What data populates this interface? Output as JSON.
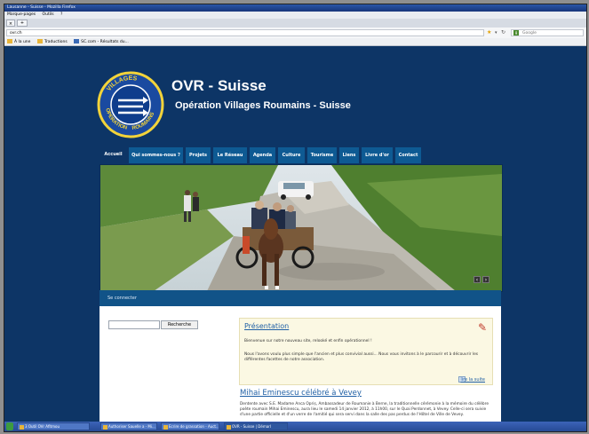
{
  "browser": {
    "title": "Lausanne - Suisse - Mozilla Firefox",
    "menu": [
      "Marque-pages",
      "Outils",
      "?"
    ],
    "tab_close": "×",
    "new_tab": "+",
    "url": "ovr.ch",
    "search_engine_label": "g",
    "search_placeholder": "Google",
    "bookmarks": [
      "À la une",
      "Traductions",
      "SC.com - Résultats du..."
    ]
  },
  "site": {
    "title": "OVR - Suisse",
    "subtitle": "Opération Villages Roumains - Suisse",
    "logo": {
      "top_arc": "VILLAGES",
      "right_arc": "ROUMAINS",
      "left_arc": "OPERATION"
    }
  },
  "nav": [
    {
      "label": "Accueil",
      "active": true
    },
    {
      "label": "Qui sommes-nous ?"
    },
    {
      "label": "Projets"
    },
    {
      "label": "Le Réseau"
    },
    {
      "label": "Agenda"
    },
    {
      "label": "Culture"
    },
    {
      "label": "Tourisme"
    },
    {
      "label": "Liens"
    },
    {
      "label": "Livre d'or"
    },
    {
      "label": "Contact"
    }
  ],
  "slider": {
    "prev": "‹",
    "next": "›"
  },
  "connect": {
    "label": "Se connecter"
  },
  "search": {
    "value": "",
    "button": "Recherche"
  },
  "presentation": {
    "title": "Présentation",
    "p1": "Bienvenue sur notre nouveau site, relooké et enfin opérationnel !",
    "p2": "Nous l'avons voulu plus simple que l'ancien et plus convivial aussi... Nous vous invitons à le parcourir et à découvrir les différentes facettes de notre association.",
    "more": "lire la suite"
  },
  "article": {
    "title": "Mihai Eminescu célébré à Vevey",
    "text": "Dentente avec S.E. Madame Anca Opriș, Ambassadeur de Roumanie à Berne, la traditionnelle cérémonie à la mémoire du célèbre poète roumain Mihai Eminescu, aura lieu le samedi 14 janvier 2012, à 11h00, sur le Quai Perdonnet, à Vevey. Celle-ci sera suivie d'une partie officielle et d'un verre de l'amitié qui sera servi dans la salle des pas perdus de l'Hôtel de Ville de Vevey."
  },
  "taskbar": [
    "3 Outil OVr Afitmou",
    "Authoriser Sauelle a - Mi...",
    "Ecrire de grassation - Auct...",
    "OVR - Suisse | Démarl"
  ]
}
